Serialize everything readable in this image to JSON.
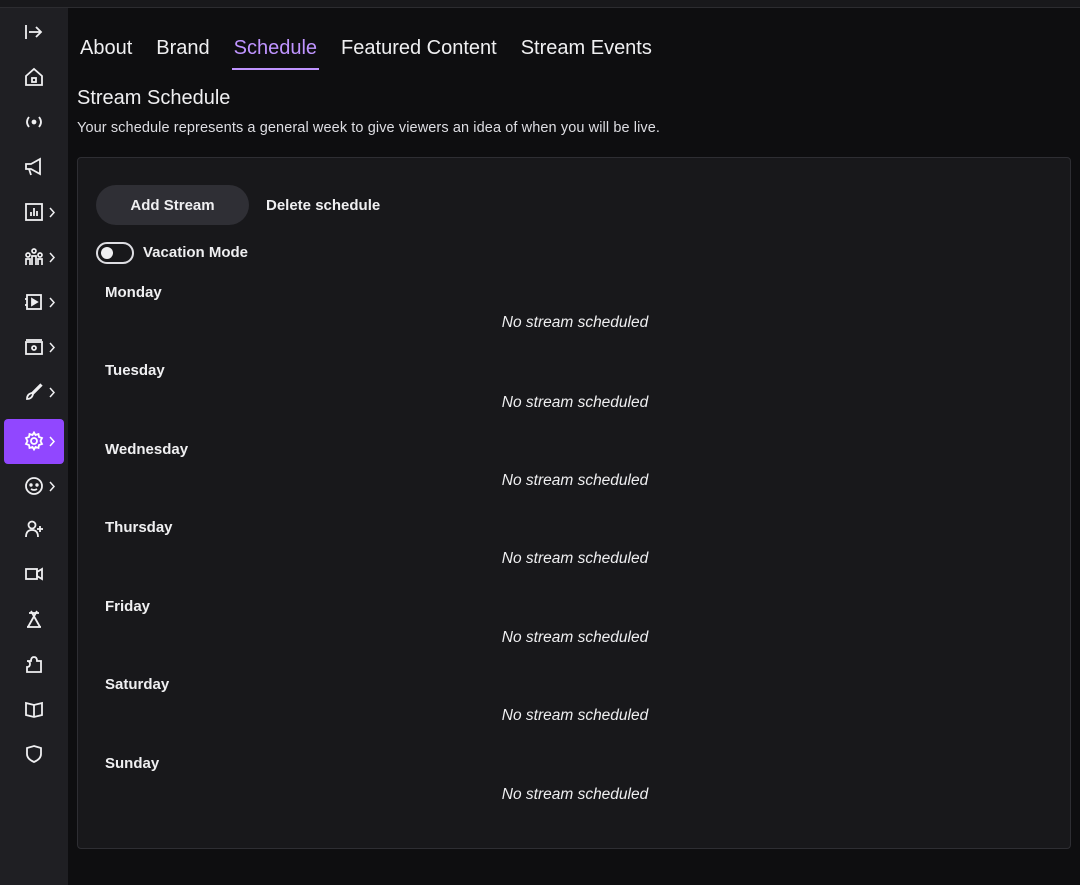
{
  "tabs": [
    {
      "label": "About"
    },
    {
      "label": "Brand"
    },
    {
      "label": "Schedule",
      "active": true
    },
    {
      "label": "Featured Content"
    },
    {
      "label": "Stream Events"
    }
  ],
  "sidebar": {
    "items": [
      {
        "icon": "collapse-arrow-icon"
      },
      {
        "icon": "home-icon"
      },
      {
        "icon": "broadcast-icon"
      },
      {
        "icon": "megaphone-icon"
      },
      {
        "icon": "analytics-icon"
      },
      {
        "icon": "community-icon"
      },
      {
        "icon": "content-icon"
      },
      {
        "icon": "monetization-icon"
      },
      {
        "icon": "customization-icon"
      },
      {
        "icon": "settings-icon",
        "active": true
      },
      {
        "icon": "emotes-icon"
      },
      {
        "icon": "add-friend-icon"
      },
      {
        "icon": "video-icon"
      },
      {
        "icon": "creator-camp-icon"
      },
      {
        "icon": "extensions-icon"
      },
      {
        "icon": "help-book-icon"
      },
      {
        "icon": "safety-shield-icon"
      }
    ]
  },
  "section": {
    "title": "Stream Schedule",
    "description": "Your schedule represents a general week to give viewers an idea of when you will be live."
  },
  "actions": {
    "add_stream": "Add Stream",
    "delete_schedule": "Delete schedule"
  },
  "vacation": {
    "label": "Vacation Mode",
    "enabled": false
  },
  "days": [
    {
      "name": "Monday",
      "status": "No stream scheduled"
    },
    {
      "name": "Tuesday",
      "status": "No stream scheduled"
    },
    {
      "name": "Wednesday",
      "status": "No stream scheduled"
    },
    {
      "name": "Thursday",
      "status": "No stream scheduled"
    },
    {
      "name": "Friday",
      "status": "No stream scheduled"
    },
    {
      "name": "Saturday",
      "status": "No stream scheduled"
    },
    {
      "name": "Sunday",
      "status": "No stream scheduled"
    }
  ],
  "colors": {
    "accent": "#9147ff",
    "tab_active": "#bf94ff",
    "background": "#0e0e10",
    "panel": "#18181b"
  }
}
